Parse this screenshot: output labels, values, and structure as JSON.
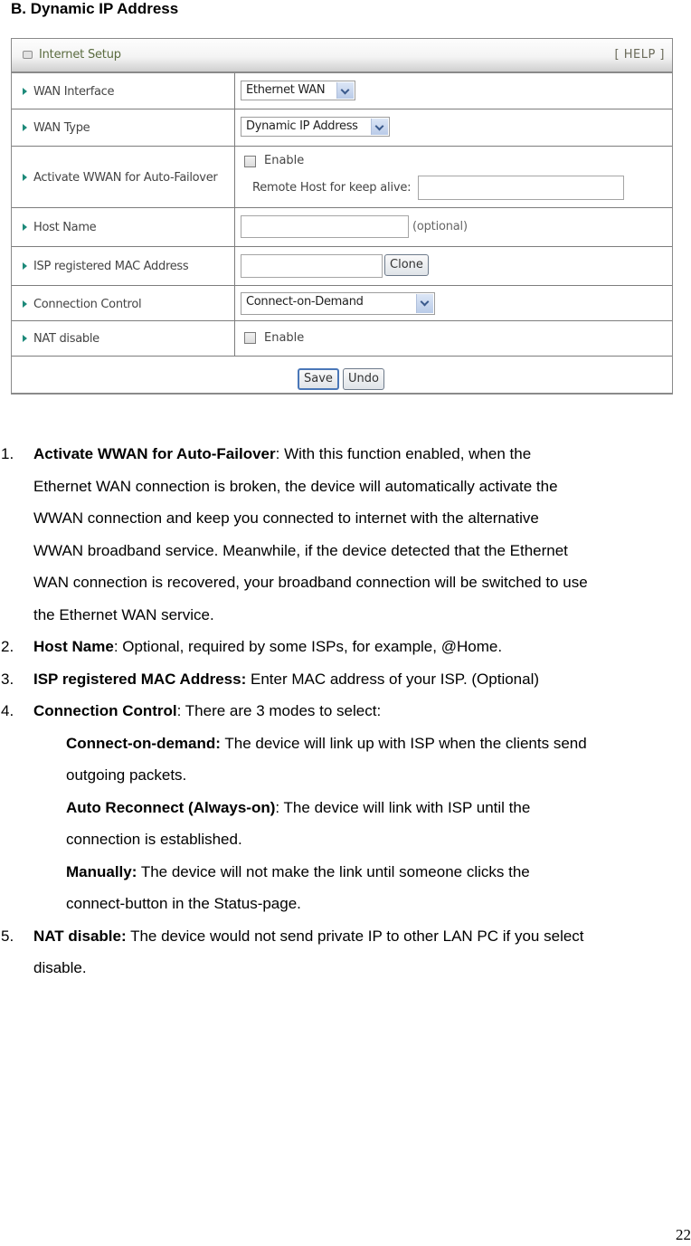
{
  "section_title": "B. Dynamic IP Address",
  "panel": {
    "title": "Internet Setup",
    "help": "[ HELP ]",
    "rows": {
      "wan_interface": {
        "label": "WAN Interface",
        "value": "Ethernet WAN"
      },
      "wan_type": {
        "label": "WAN Type",
        "value": "Dynamic IP Address"
      },
      "auto_failover": {
        "label": "Activate WWAN for Auto-Failover",
        "checkbox_label": "Enable",
        "checked": false,
        "remote_host_label": "Remote Host for keep alive:",
        "remote_host_value": ""
      },
      "host_name": {
        "label": "Host Name",
        "value": "",
        "hint": "(optional)"
      },
      "mac": {
        "label": "ISP registered MAC Address",
        "value": "",
        "button": "Clone"
      },
      "connection_control": {
        "label": "Connection Control",
        "value": "Connect-on-Demand"
      },
      "nat_disable": {
        "label": "NAT disable",
        "checkbox_label": "Enable",
        "checked": false
      }
    },
    "buttons": {
      "save": "Save",
      "undo": "Undo"
    }
  },
  "items": [
    {
      "num": "1.",
      "term": "Activate WWAN for Auto-Failover",
      "sep": ": ",
      "lines": [
        "With this function enabled, when the",
        "Ethernet WAN connection is broken, the device will automatically activate the",
        "WWAN connection and keep you connected to internet with the alternative",
        "WWAN broadband service. Meanwhile, if the device detected that the Ethernet",
        "WAN connection is recovered, your broadband connection will be switched to use",
        "the Ethernet WAN service."
      ]
    },
    {
      "num": "2.",
      "term": "Host Name",
      "sep": ": ",
      "text": "Optional, required by some ISPs, for example, @Home."
    },
    {
      "num": "3.",
      "term": "ISP registered MAC Address:",
      "sep": " ",
      "text": "Enter MAC address of your ISP. (Optional)"
    },
    {
      "num": "4.",
      "term": "Connection Control",
      "sep": ": ",
      "text": "There are 3 modes to select:",
      "modes": [
        {
          "term": "Connect-on-demand:",
          "sep": " ",
          "line1": "The device will link up with ISP when the clients send",
          "line2": "outgoing packets."
        },
        {
          "term": "Auto Reconnect (Always-on)",
          "sep": ": ",
          "line1": "The device will link with ISP until the",
          "line2": "connection is established."
        },
        {
          "term": "Manually:",
          "sep": " ",
          "line1": "The device will not make the link until someone clicks the",
          "line2": "connect-button in the Status-page."
        }
      ]
    },
    {
      "num": "5.",
      "term": "NAT disable:",
      "sep": " ",
      "line1": "The device would not send private IP to other LAN PC if you select",
      "line2": "disable."
    }
  ],
  "page_number": "22"
}
